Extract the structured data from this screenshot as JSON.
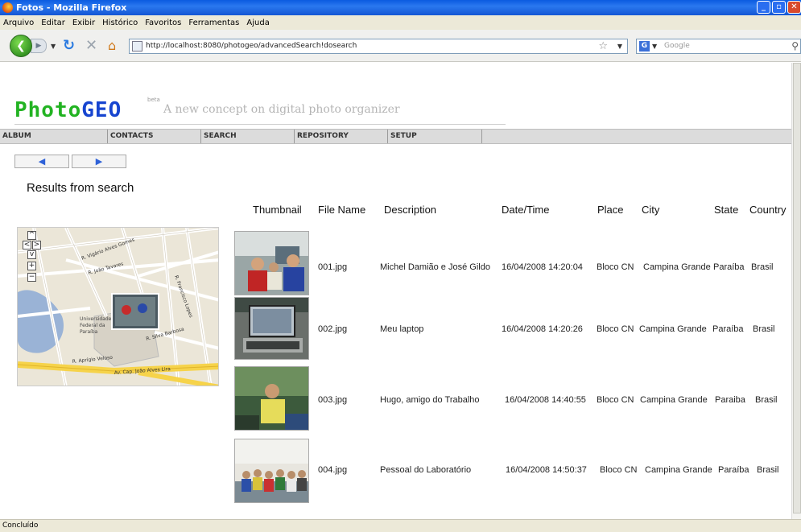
{
  "window": {
    "title": "Fotos - Mozilla Firefox"
  },
  "menu": {
    "items": [
      "Arquivo",
      "Editar",
      "Exibir",
      "Histórico",
      "Favoritos",
      "Ferramentas",
      "Ajuda"
    ]
  },
  "toolbar": {
    "url": "http://localhost:8080/photogeo/advancedSearch!dosearch",
    "search_placeholder": "Google"
  },
  "site": {
    "logo_part1": "Photo",
    "logo_part2": "GEO",
    "beta": "beta",
    "tagline": "A new concept on digital photo organizer",
    "tabs": [
      "ALBUM",
      "CONTACTS",
      "SEARCH",
      "REPOSITORY",
      "SETUP"
    ],
    "pager": {
      "prev": "◀",
      "next": "▶"
    },
    "results_title": "Results from search"
  },
  "table": {
    "headers": [
      "Thumbnail",
      "File Name",
      "Description",
      "Date/Time",
      "Place",
      "City",
      "State",
      "Country"
    ],
    "rows": [
      {
        "file": "001.jpg",
        "description": "Michel Damião e José Gildo",
        "datetime": "16/04/2008 14:20:04",
        "place": "Bloco CN",
        "city": "Campina Grande",
        "state": "Paraíba",
        "country": "Brasil"
      },
      {
        "file": "002.jpg",
        "description": "Meu laptop",
        "datetime": "16/04/2008 14:20:26",
        "place": "Bloco CN",
        "city": "Campina Grande",
        "state": "Paraíba",
        "country": "Brasil"
      },
      {
        "file": "003.jpg",
        "description": "Hugo, amigo do Trabalho",
        "datetime": "16/04/2008 14:40:55",
        "place": "Bloco CN",
        "city": "Campina Grande",
        "state": "Paraiba",
        "country": "Brasil"
      },
      {
        "file": "004.jpg",
        "description": "Pessoal do Laboratório",
        "datetime": "16/04/2008 14:50:37",
        "place": "Bloco CN",
        "city": "Campina Grande",
        "state": "Paraíba",
        "country": "Brasil"
      }
    ]
  },
  "map": {
    "streets": [
      "R. Aprígio Veloso",
      "Av. Cap. João Alves Lira",
      "R. Silva Barbosa",
      "R. Francisco Lopes",
      "R. Vigário Alves Gomes",
      "R. João Tavares"
    ],
    "place_label": "Universidade Federal da Paraíba"
  },
  "status": {
    "text": "Concluído"
  }
}
